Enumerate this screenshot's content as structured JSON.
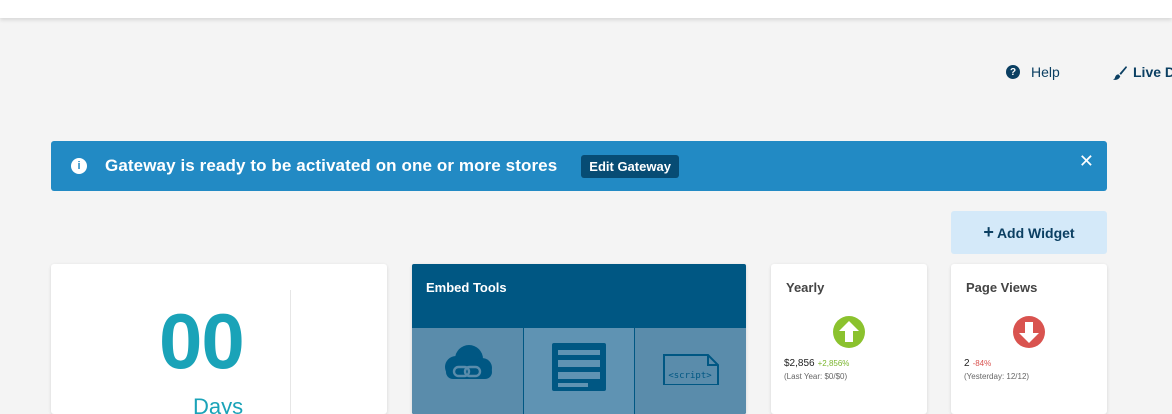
{
  "header": {
    "help_label": "Help",
    "live_label": "Live D"
  },
  "banner": {
    "message": "Gateway is ready to be activated on one or more stores",
    "edit_label": "Edit Gateway",
    "close_glyph": "✕",
    "color": "#228ac4"
  },
  "add_widget": {
    "label": "Add Widget",
    "plus": "+"
  },
  "countdown": {
    "value": "00",
    "unit": "Days"
  },
  "embed_tools": {
    "title": "Embed Tools",
    "tiles": [
      {
        "icon": "cloud-link-icon"
      },
      {
        "icon": "form-icon"
      },
      {
        "icon": "script-icon",
        "label": "<script>"
      }
    ]
  },
  "yearly": {
    "title": "Yearly",
    "value": "$2,856",
    "change": "+2,856%",
    "sub": "(Last Year: $0/$0)",
    "trend": "up"
  },
  "page_views": {
    "title": "Page Views",
    "value": "2",
    "change": "-84%",
    "sub": "(Yesterday: 12/12)",
    "trend": "down"
  }
}
